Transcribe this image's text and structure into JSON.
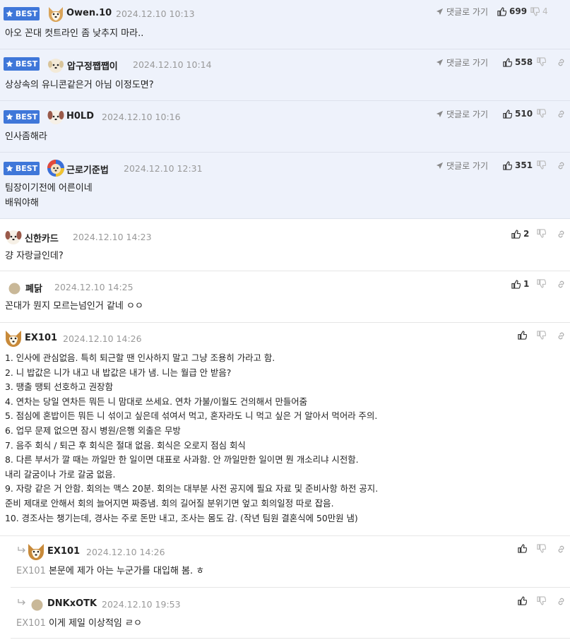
{
  "labels": {
    "best": "BEST",
    "reply_link": "댓글로 가기"
  },
  "colors": {
    "best_bg": "#eef2fb",
    "badge": "#3f77d9",
    "date": "#999999"
  },
  "comments": [
    {
      "best": true,
      "avatar": "dog-avatar",
      "nick": "Owen.10",
      "date": "2024.12.10 10:13",
      "likes": "699",
      "dislikes": "4",
      "body": "아오 꼰대 컷트라인 좀 낮추지 마라.."
    },
    {
      "best": true,
      "avatar": "puppy-avatar",
      "nick": "압구정쨉쨉이",
      "date": "2024.12.10 10:14",
      "likes": "558",
      "dislikes": "",
      "body": "상상속의 유니콘같은거 아님 이정도면?"
    },
    {
      "best": true,
      "avatar": "puppy-avatar",
      "nick": "H0LD",
      "date": "2024.12.10 10:16",
      "likes": "510",
      "dislikes": "",
      "body": "인사좀해라"
    },
    {
      "best": true,
      "avatar": "colorful-dog-avatar",
      "nick": "근로기준법",
      "date": "2024.12.10 12:31",
      "likes": "351",
      "dislikes": "",
      "body": "팀장이기전에 어른이네\n배워야해"
    },
    {
      "best": false,
      "avatar": "puppy-avatar",
      "nick": "신한카드",
      "date": "2024.12.10 14:23",
      "likes": "2",
      "dislikes": "",
      "body": "걍 자랑글인데?"
    },
    {
      "best": false,
      "avatar": "circle-avatar",
      "nick": "폐닭",
      "date": "2024.12.10 14:25",
      "likes": "1",
      "dislikes": "",
      "body": "꼰대가 뭔지 모르는넘인거 같네 ㅇㅇ"
    },
    {
      "best": false,
      "avatar": "fox-avatar",
      "nick": "EX101",
      "date": "2024.12.10 14:26",
      "likes": "",
      "dislikes": "",
      "body": "1. 인사에 관심없음. 특히 퇴근할 땐 인사하지 말고 그냥 조용히 가라고 함.\n2. 니 밥값은 니가 내고 내 밥값은 내가 냄. 니는 월급 안 받음?\n3. 땡출 땡퇴 선호하고 권장함\n4. 연차는 당일 연차든 뭐든 니 맘대로 쓰세요. 연차 가불/이월도 건의해서 만들어줌\n5. 점심에 혼밥이든 뭐든 니 섞이고 싶은데 섞여서 먹고, 혼자라도 니 먹고 싶은 거 알아서 먹어라 주의.\n6. 업무 문제 없으면 잠시 병원/은행 외출은 무방\n7. 음주 회식 / 퇴근 후 회식은 절대 없음. 회식은 오로지 점심 회식\n8. 다른 부서가 깔 때는 까일만 한 일이면 대표로 사과함. 안 까일만한 일이면 뭔 개소리냐 시전함.\n내리 갈굼이나 가로 갈굼 없음.\n9. 자랑 같은 거 안함. 회의는 맥스 20분. 회의는 대부분 사전 공지에 필요 자료 및 준비사항 하전 공지.\n준비 제대로 안해서 회의 늘어지면 짜증냄. 회의 길어질 분위기면 엎고 회의일정 따로 잡음.\n10. 경조사는 챙기는데, 경사는 주로 돈만 내고, 조사는 몸도 감. (작년 팀원 결혼식에 50만원 냄)"
    },
    {
      "best": false,
      "reply": true,
      "avatar": "fox-avatar",
      "nick": "EX101",
      "date": "2024.12.10 14:26",
      "likes": "",
      "dislikes": "",
      "mention": "EX101",
      "body": "본문에 제가 아는 누군가를 대입해 봄. ㅎ"
    },
    {
      "best": false,
      "reply": true,
      "avatar": "circle-avatar",
      "nick": "DNKxOTK",
      "date": "2024.12.10 19:53",
      "likes": "",
      "dislikes": "",
      "mention": "EX101",
      "body": "이게 제일 이상적임 ㄹㅇ"
    }
  ]
}
